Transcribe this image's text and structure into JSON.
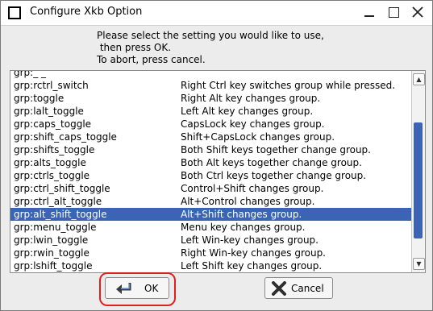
{
  "window": {
    "title": "Configure Xkb Option",
    "icon": "window-app-icon",
    "controls": [
      "minimize-icon",
      "maximize-icon",
      "close-icon"
    ]
  },
  "prompt": {
    "line1": "Please select the setting you would like to use,",
    "line2": " then press OK.",
    "line3": "To abort, press cancel."
  },
  "list": {
    "partial_top": {
      "option": "grp:_ _",
      "description": ""
    },
    "items": [
      {
        "option": "grp:rctrl_switch",
        "description": "Right Ctrl key switches group while pressed."
      },
      {
        "option": "grp:toggle",
        "description": "Right Alt key changes group."
      },
      {
        "option": "grp:lalt_toggle",
        "description": "Left Alt key changes group."
      },
      {
        "option": "grp:caps_toggle",
        "description": "CapsLock key changes group."
      },
      {
        "option": "grp:shift_caps_toggle",
        "description": "Shift+CapsLock changes group."
      },
      {
        "option": "grp:shifts_toggle",
        "description": "Both Shift keys together change group."
      },
      {
        "option": "grp:alts_toggle",
        "description": "Both Alt keys together change group."
      },
      {
        "option": "grp:ctrls_toggle",
        "description": "Both Ctrl keys together change group."
      },
      {
        "option": "grp:ctrl_shift_toggle",
        "description": "Control+Shift changes group."
      },
      {
        "option": "grp:ctrl_alt_toggle",
        "description": "Alt+Control changes group."
      },
      {
        "option": "grp:alt_shift_toggle",
        "description": "Alt+Shift changes group."
      },
      {
        "option": "grp:menu_toggle",
        "description": "Menu key changes group."
      },
      {
        "option": "grp:lwin_toggle",
        "description": "Left Win-key changes group."
      },
      {
        "option": "grp:rwin_toggle",
        "description": "Right Win-key changes group."
      },
      {
        "option": "grp:lshift_toggle",
        "description": "Left Shift key changes group."
      }
    ],
    "selected_index": 10,
    "scrollbar": {
      "up_icon": "arrow-up-icon",
      "down_icon": "arrow-down-icon"
    }
  },
  "buttons": {
    "ok": {
      "label": "OK",
      "icon": "return-arrow-icon"
    },
    "cancel": {
      "label": "Cancel",
      "icon": "cancel-x-icon"
    }
  },
  "colors": {
    "selection": "#3c64b4",
    "highlight_ring": "#e01f1f"
  }
}
